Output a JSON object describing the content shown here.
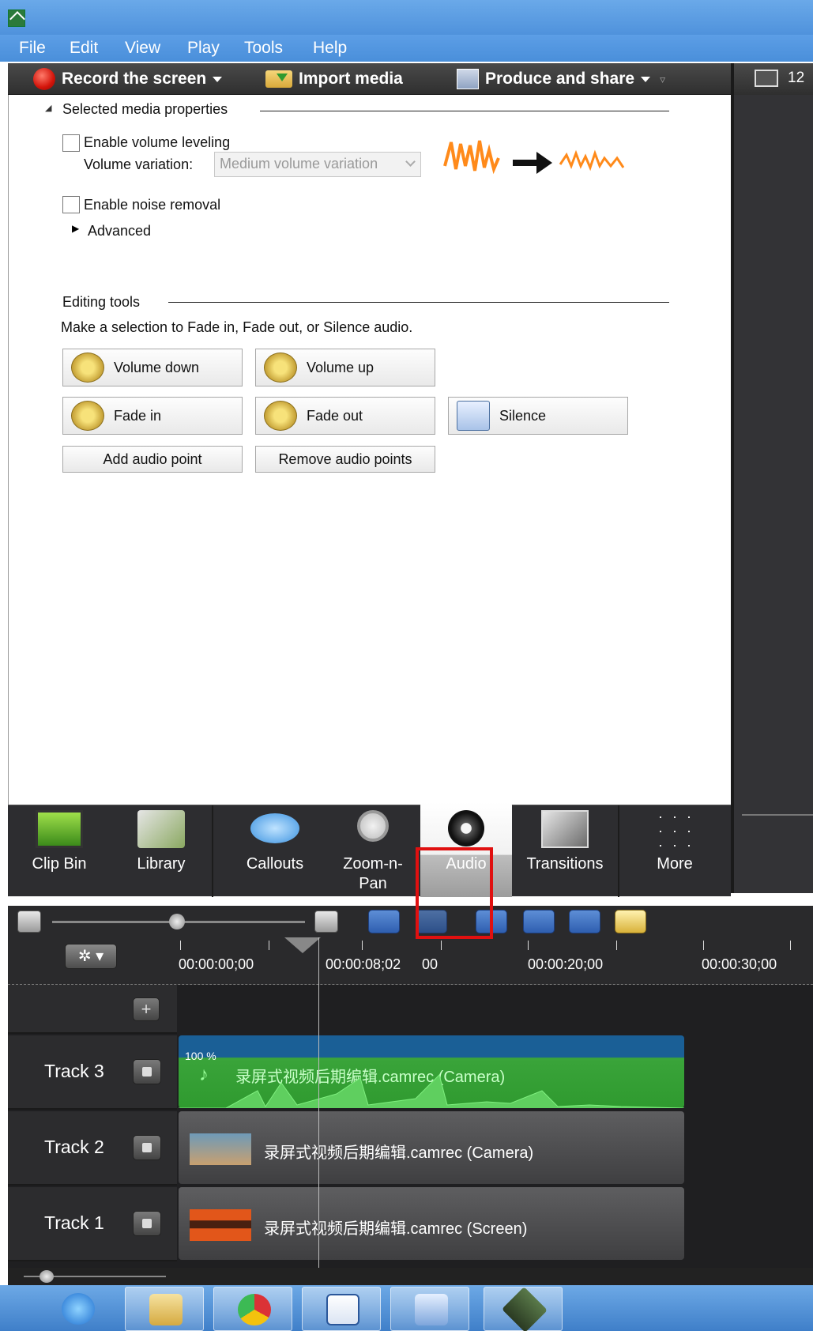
{
  "menu": [
    "File",
    "Edit",
    "View",
    "Play",
    "Tools",
    "Help"
  ],
  "toolbar": {
    "record_label": "Record the screen",
    "import_label": "Import media",
    "produce_label": "Produce and share"
  },
  "preview": {
    "size_label": "12"
  },
  "properties": {
    "section_title": "Selected media properties",
    "volume_leveling_label": "Enable volume leveling",
    "volume_variation_label": "Volume variation:",
    "volume_variation_value": "Medium volume variation",
    "noise_removal_label": "Enable noise removal",
    "advanced_label": "Advanced"
  },
  "editing_tools": {
    "section_title": "Editing tools",
    "hint": "Make a selection to Fade in, Fade out, or Silence audio.",
    "volume_down": "Volume down",
    "volume_up": "Volume up",
    "fade_in": "Fade in",
    "fade_out": "Fade out",
    "silence": "Silence",
    "add_audio_point": "Add audio point",
    "remove_audio_points": "Remove audio points"
  },
  "tabs": [
    {
      "label": "Clip Bin",
      "icon": "filmstrip-icon"
    },
    {
      "label": "Library",
      "icon": "library-icon"
    },
    {
      "label": "Callouts",
      "icon": "callout-icon"
    },
    {
      "label": "Zoom-n-\nPan",
      "icon": "magnifier-icon"
    },
    {
      "label": "Audio",
      "icon": "speaker-icon"
    },
    {
      "label": "Transitions",
      "icon": "transitions-icon"
    },
    {
      "label": "More",
      "icon": "more-icon"
    }
  ],
  "timeline": {
    "time_labels": [
      "00:00:00;00",
      "00:00:08;02",
      "00",
      "00:00:20;00",
      "00:00:30;00"
    ],
    "tracks": [
      {
        "name": "Track 3",
        "clip": "录屏式视频后期编辑.camrec (Camera)",
        "volume": "100 %"
      },
      {
        "name": "Track 2",
        "clip": "录屏式视频后期编辑.camrec (Camera)"
      },
      {
        "name": "Track 1",
        "clip": "录屏式视频后期编辑.camrec (Screen)"
      }
    ]
  },
  "colors": {
    "audio_clip": "#3aa43a",
    "highlight": "#e01010",
    "taskbar": "#4f8ed8"
  }
}
